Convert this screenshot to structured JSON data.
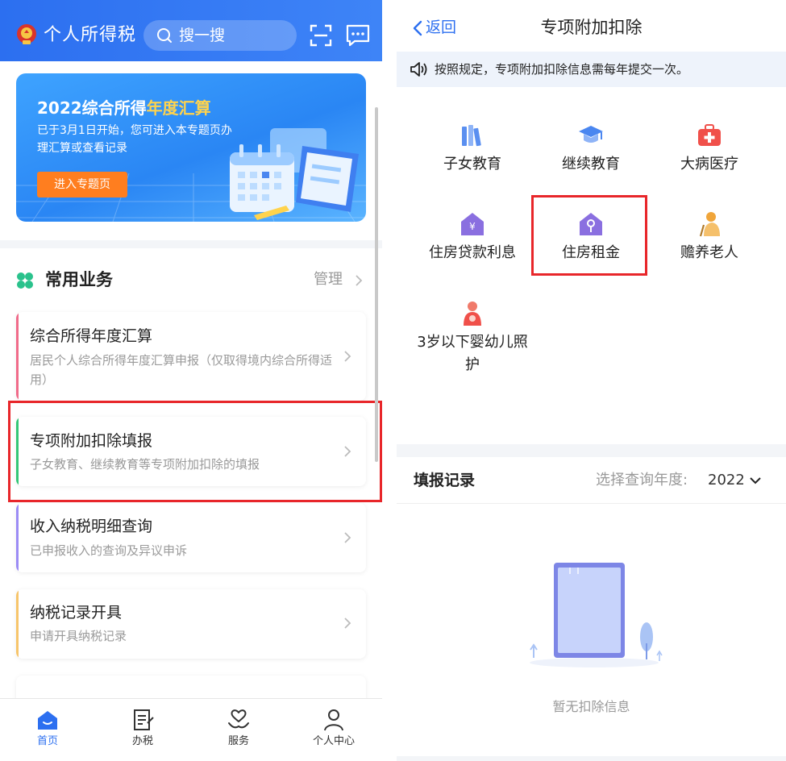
{
  "left": {
    "app_title": "个人所得税",
    "search_placeholder": "搜一搜",
    "banner": {
      "title_prefix": "2022综合所得",
      "title_highlight": "年度汇算",
      "description": "已于3月1日开始，您可进入本专题页办理汇算或查看记录",
      "button_label": "进入专题页"
    },
    "common": {
      "title": "常用业务",
      "manage_label": "管理"
    },
    "cards": [
      {
        "title": "综合所得年度汇算",
        "desc": "居民个人综合所得年度汇算申报（仅取得境内综合所得适用）",
        "accent": "#f06b8a"
      },
      {
        "title": "专项附加扣除填报",
        "desc": "子女教育、继续教育等专项附加扣除的填报",
        "accent": "#34c777"
      },
      {
        "title": "收入纳税明细查询",
        "desc": "已申报收入的查询及异议申诉",
        "accent": "#9b8cf5"
      },
      {
        "title": "纳税记录开具",
        "desc": "申请开具纳税记录",
        "accent": "#f7c56b"
      }
    ],
    "bottom_nav": [
      {
        "label": "首页",
        "icon": "home-icon",
        "active": true
      },
      {
        "label": "办税",
        "icon": "form-icon",
        "active": false
      },
      {
        "label": "服务",
        "icon": "heart-hands-icon",
        "active": false
      },
      {
        "label": "个人中心",
        "icon": "person-icon",
        "active": false
      }
    ]
  },
  "right": {
    "back_label": "返回",
    "title": "专项附加扣除",
    "notice": "按照规定，专项附加扣除信息需每年提交一次。",
    "categories": [
      {
        "label": "子女教育",
        "icon": "books-icon"
      },
      {
        "label": "继续教育",
        "icon": "graduation-cap-icon"
      },
      {
        "label": "大病医疗",
        "icon": "medical-kit-icon"
      },
      {
        "label": "住房贷款利息",
        "icon": "house-yuan-icon"
      },
      {
        "label": "住房租金",
        "icon": "house-key-icon"
      },
      {
        "label": "赡养老人",
        "icon": "elderly-icon"
      },
      {
        "label_line1": "3岁以下婴幼儿照",
        "label_line2": "护",
        "icon": "mother-baby-icon"
      }
    ],
    "records": {
      "title": "填报记录",
      "year_label": "选择查询年度:",
      "year_value": "2022",
      "empty_text": "暂无扣除信息"
    }
  },
  "colors": {
    "primary": "#2c6ff0",
    "highlight_box": "#e8262a",
    "orange_button": "#ff7e1f",
    "icon_purple": "#8a6fe0",
    "icon_red": "#f0504a",
    "icon_blue": "#4a86f0"
  }
}
